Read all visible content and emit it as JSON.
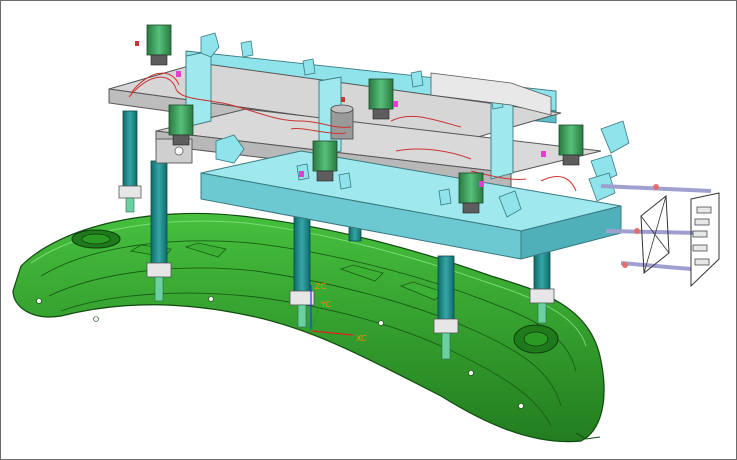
{
  "viewport": {
    "background": "#ffffff",
    "border_color": "#6b6b6b"
  },
  "colors": {
    "bumper_green": "#2fa52a",
    "bumper_dark": "#1f6e1c",
    "frame_gray": "#c9c9c9",
    "frame_outline": "#555555",
    "cyan_bracket": "#7fdce4",
    "column_teal": "#1c8c8c",
    "cylinder_green": "#3c9a5a",
    "cable_red": "#cc3333",
    "magenta_mark": "#e040d0",
    "axis_x_red": "#e02020",
    "axis_y_green": "#20a020",
    "axis_z_blue": "#2040e0",
    "axis_label": "#ff8800"
  },
  "triad": {
    "x_label": "XC",
    "y_label": "YC",
    "z_label": "ZC"
  }
}
